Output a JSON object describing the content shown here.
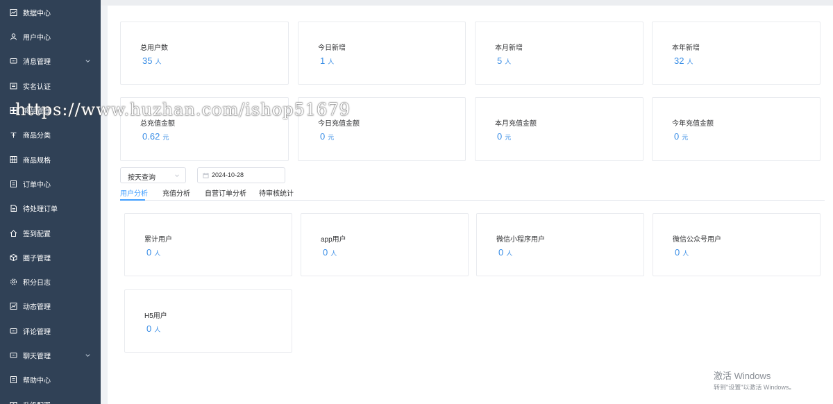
{
  "sidebar": {
    "items": [
      {
        "label": "数据中心",
        "icon": "dashboard-icon",
        "has_submenu": false
      },
      {
        "label": "用户中心",
        "icon": "user-icon",
        "has_submenu": false
      },
      {
        "label": "消息管理",
        "icon": "message-icon",
        "has_submenu": true
      },
      {
        "label": "实名认证",
        "icon": "id-card-icon",
        "has_submenu": false
      },
      {
        "label": "商品管理",
        "icon": "goods-icon",
        "has_submenu": false
      },
      {
        "label": "商品分类",
        "icon": "category-icon",
        "has_submenu": false
      },
      {
        "label": "商品规格",
        "icon": "grid-icon",
        "has_submenu": false
      },
      {
        "label": "订单中心",
        "icon": "order-icon",
        "has_submenu": false
      },
      {
        "label": "待处理订单",
        "icon": "pending-order-icon",
        "has_submenu": false
      },
      {
        "label": "签到配置",
        "icon": "home-icon",
        "has_submenu": false
      },
      {
        "label": "圈子管理",
        "icon": "cube-icon",
        "has_submenu": false
      },
      {
        "label": "积分日志",
        "icon": "gear-icon",
        "has_submenu": false
      },
      {
        "label": "动态管理",
        "icon": "chart-icon",
        "has_submenu": false
      },
      {
        "label": "评论管理",
        "icon": "comment-icon",
        "has_submenu": false
      },
      {
        "label": "聊天管理",
        "icon": "chat-icon",
        "has_submenu": true
      },
      {
        "label": "帮助中心",
        "icon": "help-icon",
        "has_submenu": false
      },
      {
        "label": "升级配置",
        "icon": "upgrade-icon",
        "has_submenu": false
      }
    ]
  },
  "stats": {
    "row1": [
      {
        "title": "总用户数",
        "value": "35",
        "unit": "人"
      },
      {
        "title": "今日新增",
        "value": "1",
        "unit": "人"
      },
      {
        "title": "本月新增",
        "value": "5",
        "unit": "人"
      },
      {
        "title": "本年新增",
        "value": "32",
        "unit": "人"
      }
    ],
    "row2": [
      {
        "title": "总充值金额",
        "value": "0.62",
        "unit": "元"
      },
      {
        "title": "今日充值金额",
        "value": "0",
        "unit": "元"
      },
      {
        "title": "本月充值金额",
        "value": "0",
        "unit": "元"
      },
      {
        "title": "今年充值金额",
        "value": "0",
        "unit": "元"
      }
    ]
  },
  "filters": {
    "query_mode": "按天查询",
    "date": "2024-10-28"
  },
  "tabs": [
    "用户分析",
    "充值分析",
    "自营订单分析",
    "待审核统计"
  ],
  "active_tab": 0,
  "user_stats": [
    {
      "title": "累计用户",
      "value": "0",
      "unit": "人"
    },
    {
      "title": "app用户",
      "value": "0",
      "unit": "人"
    },
    {
      "title": "微信小程序用户",
      "value": "0",
      "unit": "人"
    },
    {
      "title": "微信公众号用户",
      "value": "0",
      "unit": "人"
    },
    {
      "title": "H5用户",
      "value": "0",
      "unit": "人"
    }
  ],
  "watermark": "https://www.huzhan.com/ishop51679",
  "os_notice": {
    "line1": "激活 Windows",
    "line2": "转到\"设置\"以激活 Windows。"
  },
  "colors": {
    "sidebar_bg": "#304156",
    "accent": "#409eff",
    "value_blue": "#3a8ee6"
  }
}
